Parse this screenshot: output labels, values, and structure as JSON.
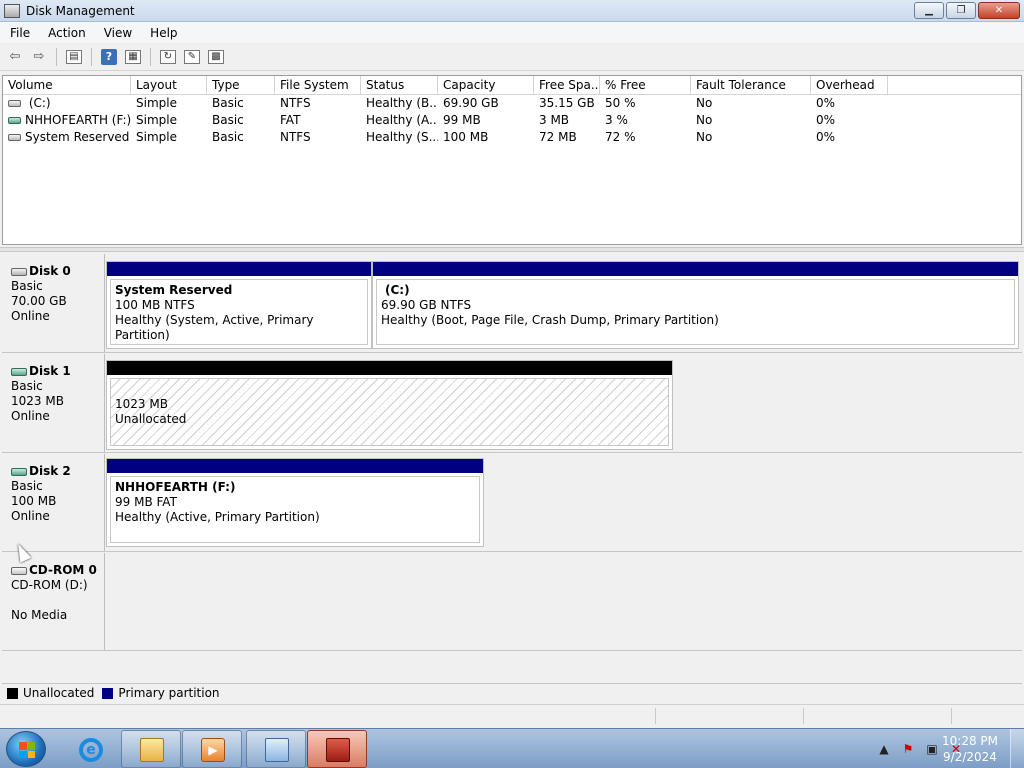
{
  "window": {
    "title": "Disk Management"
  },
  "menubar": {
    "items": [
      "File",
      "Action",
      "View",
      "Help"
    ]
  },
  "toolbar": {
    "buttons": [
      "back-icon",
      "forward-icon",
      "show-hide-console-tree-icon",
      "help-icon",
      "properties-icon",
      "refresh-icon",
      "rescan-disks-icon",
      "settings-icon"
    ]
  },
  "volume_list": {
    "columns": [
      "Volume",
      "Layout",
      "Type",
      "File System",
      "Status",
      "Capacity",
      "Free Spa...",
      "% Free",
      "Fault Tolerance",
      "Overhead"
    ],
    "rows": [
      {
        "volume": " (C:)",
        "layout": "Simple",
        "type": "Basic",
        "fs": "NTFS",
        "status": "Healthy (B...",
        "capacity": "69.90 GB",
        "free": "35.15 GB",
        "pct": "50 %",
        "fault": "No",
        "overhead": "0%"
      },
      {
        "volume": "NHHOFEARTH (F:)",
        "layout": "Simple",
        "type": "Basic",
        "fs": "FAT",
        "status": "Healthy (A...",
        "capacity": "99 MB",
        "free": "3 MB",
        "pct": "3 %",
        "fault": "No",
        "overhead": "0%"
      },
      {
        "volume": "System Reserved",
        "layout": "Simple",
        "type": "Basic",
        "fs": "NTFS",
        "status": "Healthy (S...",
        "capacity": "100 MB",
        "free": "72 MB",
        "pct": "72 %",
        "fault": "No",
        "overhead": "0%"
      }
    ]
  },
  "disks": [
    {
      "name": "Disk 0",
      "type": "Basic",
      "size": "70.00 GB",
      "state": "Online",
      "partitions": [
        {
          "name": "System Reserved",
          "size": "100 MB NTFS",
          "status": "Healthy (System, Active, Primary Partition)"
        },
        {
          "name": "(C:)",
          "size": "69.90 GB NTFS",
          "status": "Healthy (Boot, Page File, Crash Dump, Primary Partition)"
        }
      ]
    },
    {
      "name": "Disk 1",
      "type": "Basic",
      "size": "1023 MB",
      "state": "Online",
      "partitions": [
        {
          "name": "",
          "size": "1023 MB",
          "status": "Unallocated"
        }
      ]
    },
    {
      "name": "Disk 2",
      "type": "Basic",
      "size": "100 MB",
      "state": "Online",
      "partitions": [
        {
          "name": "NHHOFEARTH  (F:)",
          "size": "99 MB FAT",
          "status": "Healthy (Active, Primary Partition)"
        }
      ]
    },
    {
      "name": "CD-ROM 0",
      "type": "CD-ROM (D:)",
      "size": "",
      "state": "No Media",
      "partitions": []
    }
  ],
  "legend": [
    {
      "label": "Unallocated",
      "color": "#000000"
    },
    {
      "label": "Primary partition",
      "color": "#000080"
    }
  ],
  "taskbar": {
    "time": "10:28 PM",
    "date": "9/2/2024"
  }
}
